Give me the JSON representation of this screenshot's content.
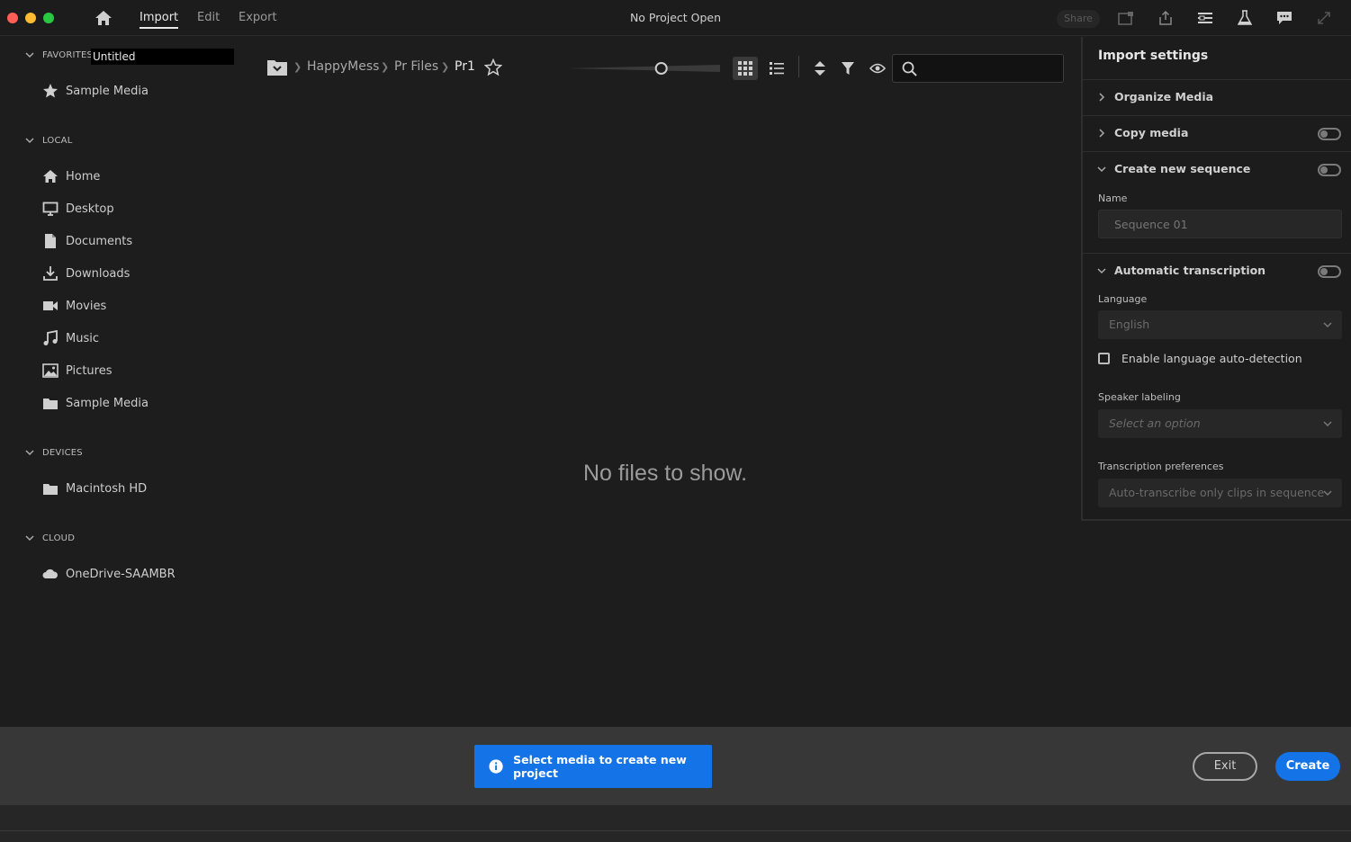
{
  "topbar": {
    "tabs": [
      "Import",
      "Edit",
      "Export"
    ],
    "title": "No Project Open",
    "share_label": "Share"
  },
  "sidebar": {
    "favorites": {
      "header": "FAVORITES",
      "rename_value": "Untitled",
      "items": [
        "Sample Media"
      ]
    },
    "local": {
      "header": "LOCAL",
      "items": [
        "Home",
        "Desktop",
        "Documents",
        "Downloads",
        "Movies",
        "Music",
        "Pictures",
        "Sample Media"
      ]
    },
    "devices": {
      "header": "DEVICES",
      "items": [
        "Macintosh HD"
      ]
    },
    "cloud": {
      "header": "CLOUD",
      "items": [
        "OneDrive-SAAMBR"
      ]
    }
  },
  "breadcrumb": [
    "HappyMess",
    "Pr Files",
    "Pr1"
  ],
  "search": {
    "value": ""
  },
  "thumbnail_zoom_fraction": 0.62,
  "main": {
    "empty_message": "No files to show."
  },
  "import_settings": {
    "title": "Import settings",
    "organize_media": "Organize Media",
    "copy_media": "Copy media",
    "create_sequence": {
      "label": "Create new sequence",
      "name_label": "Name",
      "name_placeholder": "Sequence 01"
    },
    "transcription": {
      "label": "Automatic transcription",
      "language_label": "Language",
      "language_value": "English",
      "auto_detect_label": "Enable language auto-detection",
      "speaker_label": "Speaker labeling",
      "speaker_placeholder": "Select an option",
      "prefs_label": "Transcription preferences",
      "prefs_value": "Auto-transcribe only clips in sequence"
    }
  },
  "footer": {
    "notice": "Select media to create new project",
    "exit_label": "Exit",
    "create_label": "Create"
  },
  "colors": {
    "accent": "#1473e6",
    "background": "#1d1d1d",
    "footer": "#373737"
  }
}
